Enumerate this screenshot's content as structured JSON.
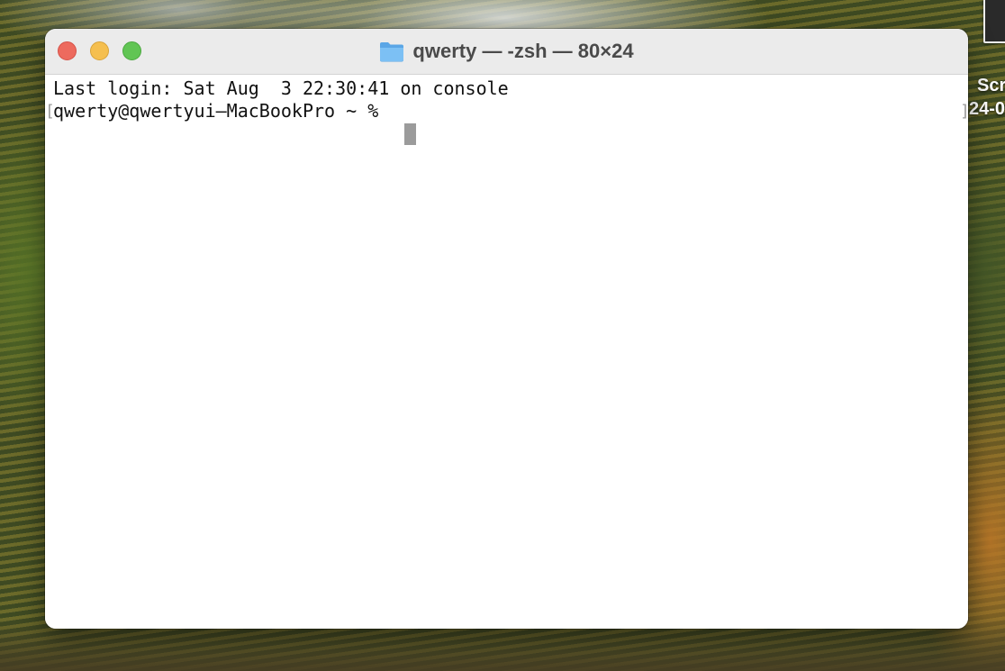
{
  "desktop": {
    "partial_label_line1": "Scr",
    "partial_label_line2": "24-0"
  },
  "window": {
    "title": "qwerty — -zsh — 80×24",
    "title_icon": "folder-icon",
    "traffic_lights": {
      "close_color": "#ed6a5e",
      "minimize_color": "#f5bf4f",
      "zoom_color": "#61c554"
    }
  },
  "terminal": {
    "lines": [
      "Last login: Sat Aug  3 22:30:41 on console",
      "qwerty@qwertyui—MacBookPro ~ %"
    ],
    "left_bracket": "[",
    "right_bracket": "]",
    "cursor_color": "#9b9b9b"
  }
}
